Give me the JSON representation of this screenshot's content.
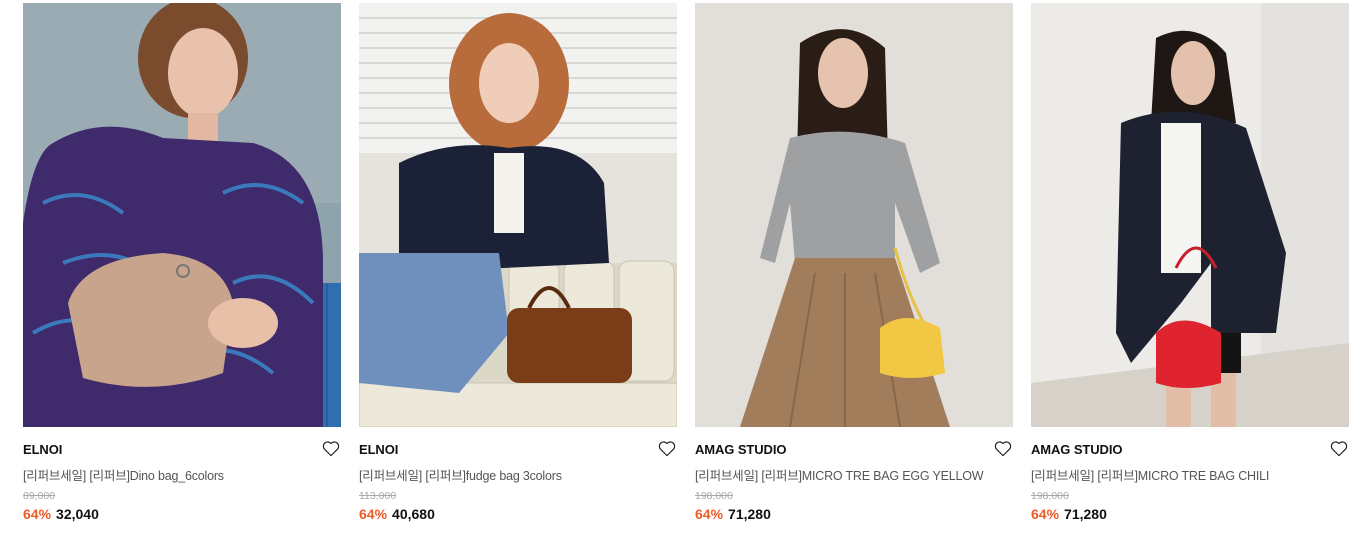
{
  "products": [
    {
      "brand": "ELNOI",
      "name": "[리퍼브세일] [리퍼브]Dino bag_6colors",
      "original_price": "89,000",
      "discount": "64%",
      "price": "32,040",
      "image_label": "Model holding a beige drawstring bag"
    },
    {
      "brand": "ELNOI",
      "name": "[리퍼브세일] [리퍼브]fudge bag 3colors",
      "original_price": "113,000",
      "discount": "64%",
      "price": "40,680",
      "image_label": "Model with a brown boston bag"
    },
    {
      "brand": "AMAG STUDIO",
      "name": "[리퍼브세일] [리퍼브]MICRO TRE BAG EGG YELLOW",
      "original_price": "198,000",
      "discount": "64%",
      "price": "71,280",
      "image_label": "Model holding a yellow mini bag"
    },
    {
      "brand": "AMAG STUDIO",
      "name": "[리퍼브세일] [리퍼브]MICRO TRE BAG CHILI",
      "original_price": "198,000",
      "discount": "64%",
      "price": "71,280",
      "image_label": "Model holding a red mini bag"
    }
  ],
  "icons": {
    "wishlist": "heart-outline-icon"
  },
  "colors": {
    "discount": "#f15a22",
    "original_price": "#aaaaaa",
    "brand": "#111111"
  }
}
